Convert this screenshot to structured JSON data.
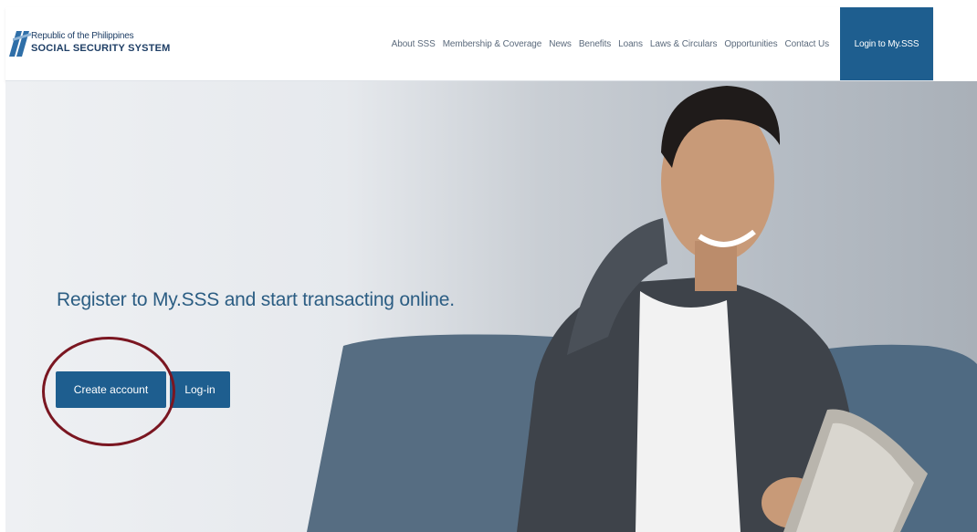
{
  "header": {
    "logo_top": "Republic of the Philippines",
    "logo_bottom": "SOCIAL SECURITY SYSTEM",
    "nav": [
      "About SSS",
      "Membership & Coverage",
      "News",
      "Benefits",
      "Loans",
      "Laws & Circulars",
      "Opportunities",
      "Contact Us"
    ],
    "login_label": "Login to My.SSS"
  },
  "hero": {
    "title": "Register to My.SSS and start transacting online.",
    "create_label": "Create account",
    "login_label": "Log-in",
    "image_icon": "person-with-tablet-photo"
  },
  "colors": {
    "brand_blue": "#1e5e8f",
    "title_blue": "#2b5d83",
    "annotation_red": "#7a1621"
  }
}
